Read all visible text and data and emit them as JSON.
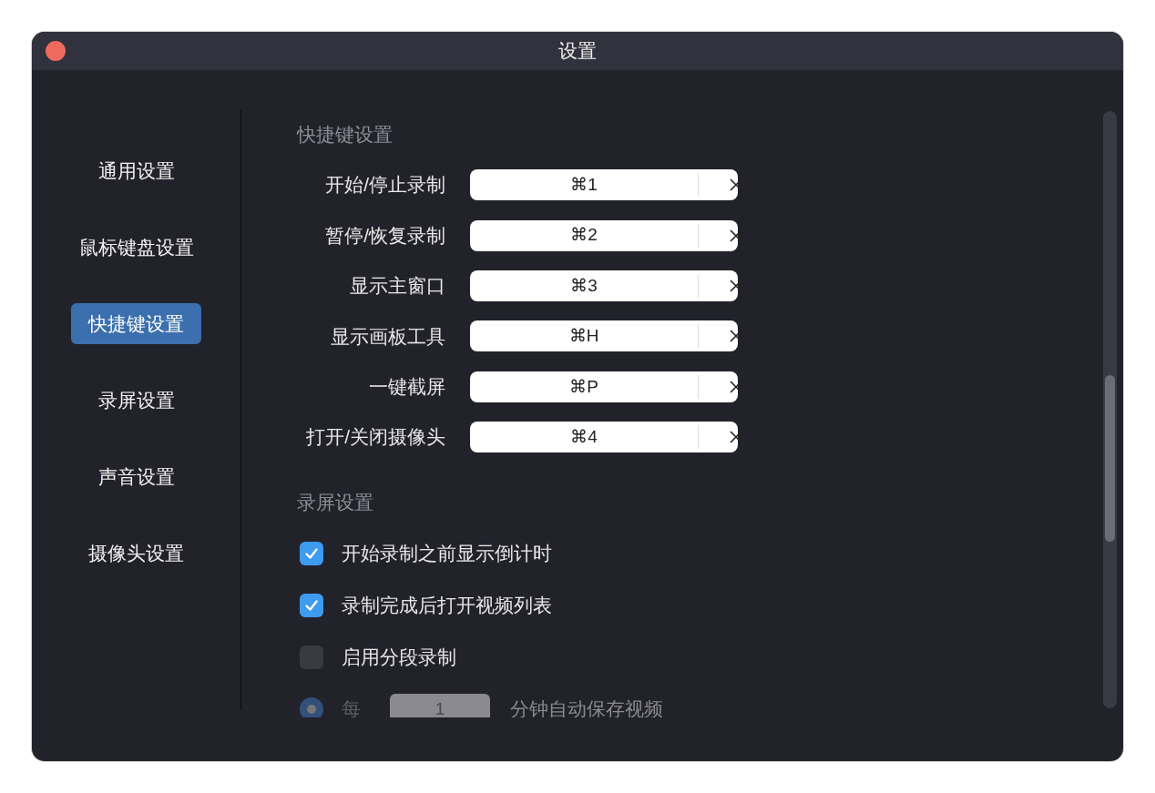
{
  "window": {
    "title": "设置"
  },
  "sidebar": {
    "items": [
      {
        "label": "通用设置",
        "selected": false
      },
      {
        "label": "鼠标键盘设置",
        "selected": false
      },
      {
        "label": "快捷键设置",
        "selected": true
      },
      {
        "label": "录屏设置",
        "selected": false
      },
      {
        "label": "声音设置",
        "selected": false
      },
      {
        "label": "摄像头设置",
        "selected": false
      }
    ]
  },
  "shortcuts": {
    "heading": "快捷键设置",
    "rows": [
      {
        "label": "开始/停止录制",
        "value": "⌘1"
      },
      {
        "label": "暂停/恢复录制",
        "value": "⌘2"
      },
      {
        "label": "显示主窗口",
        "value": "⌘3"
      },
      {
        "label": "显示画板工具",
        "value": "⌘H"
      },
      {
        "label": "一键截屏",
        "value": "⌘P"
      },
      {
        "label": "打开/关闭摄像头",
        "value": "⌘4"
      }
    ]
  },
  "recording": {
    "heading": "录屏设置",
    "options": [
      {
        "label": "开始录制之前显示倒计时",
        "checked": true
      },
      {
        "label": "录制完成后打开视频列表",
        "checked": true
      },
      {
        "label": "启用分段录制",
        "checked": false
      }
    ],
    "segment": {
      "prefix": "每",
      "value": "1",
      "suffix": "分钟自动保存视频",
      "selected": true,
      "disabled": true
    }
  }
}
